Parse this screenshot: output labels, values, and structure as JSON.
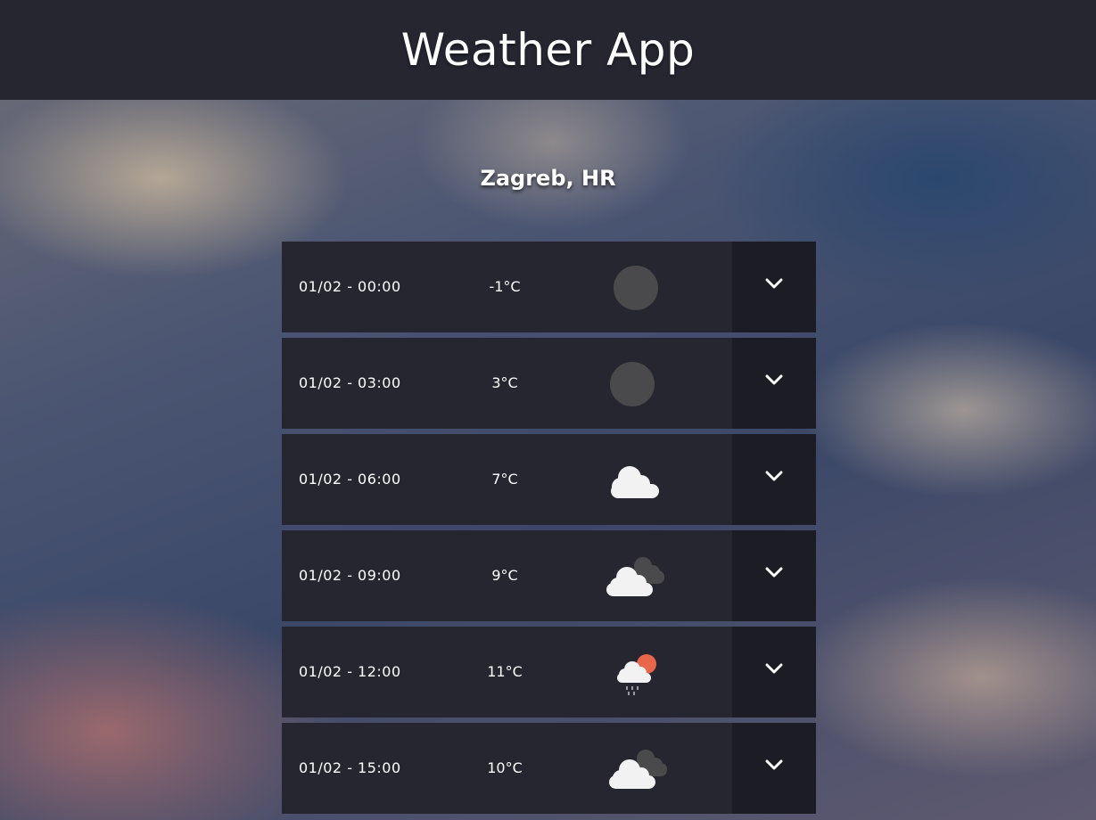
{
  "header": {
    "title": "Weather App"
  },
  "location": "Zagreb, HR",
  "forecast": [
    {
      "time": "01/02 - 00:00",
      "temp": "-1°C",
      "icon": "clear-night-icon"
    },
    {
      "time": "01/02 - 03:00",
      "temp": "3°C",
      "icon": "clear-night-icon"
    },
    {
      "time": "01/02 - 06:00",
      "temp": "7°C",
      "icon": "cloud-icon"
    },
    {
      "time": "01/02 - 09:00",
      "temp": "9°C",
      "icon": "broken-clouds-icon"
    },
    {
      "time": "01/02 - 12:00",
      "temp": "11°C",
      "icon": "sun-rain-icon"
    },
    {
      "time": "01/02 - 15:00",
      "temp": "10°C",
      "icon": "broken-clouds-icon"
    }
  ],
  "colors": {
    "header_bg": "#262631",
    "row_bg": "#262631",
    "expand_bg": "#1c1c24",
    "sun": "#e8664a",
    "moon": "#4a4a4c"
  }
}
